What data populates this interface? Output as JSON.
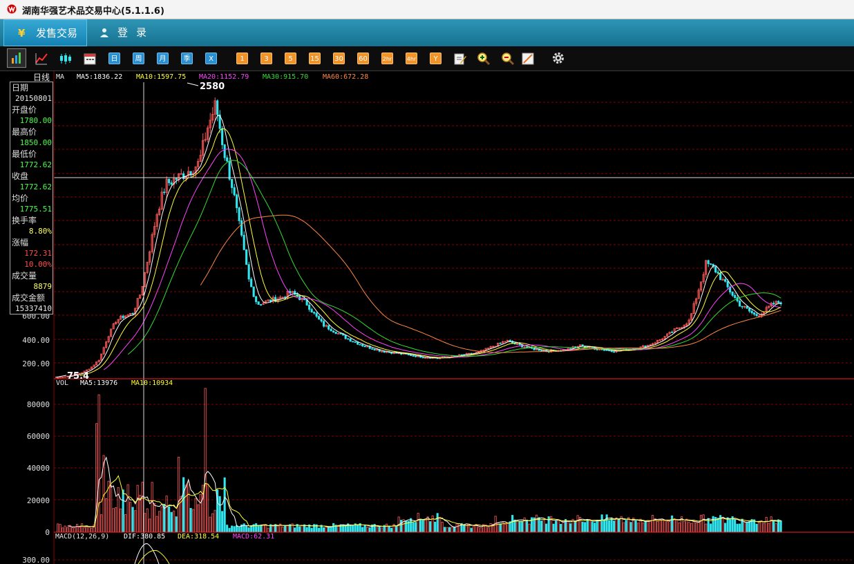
{
  "window": {
    "title": "湖南华强艺术品交易中心(5.1.1.6)"
  },
  "nav": {
    "tabs": [
      {
        "label": "发售交易",
        "icon": "yen-icon"
      },
      {
        "label": "登录",
        "icon": "user-icon"
      }
    ]
  },
  "toolbar": {
    "icon_buttons": [
      "bar-chart-icon",
      "line-chart-icon",
      "candlestick-icon",
      "calendar-icon"
    ],
    "period_buttons": [
      "日",
      "周",
      "月",
      "季",
      "X"
    ],
    "minute_buttons": [
      "1",
      "3",
      "5",
      "15",
      "30",
      "60",
      "2hr",
      "4hr",
      "Y"
    ],
    "tool_buttons": [
      "edit-icon",
      "zoom-in-icon",
      "zoom-out-icon",
      "draw-line-icon",
      "gear-icon"
    ]
  },
  "main_pane": {
    "period_label": "日线",
    "ma_label": "MA",
    "ma5": "MA5:1836.22",
    "ma10": "MA10:1597.75",
    "ma20": "MA20:1152.79",
    "ma30": "MA30:915.70",
    "ma60": "MA60:672.28",
    "y_ticks": [
      "600.00",
      "400.00",
      "200.00"
    ],
    "high_label": "2580",
    "low_label": "75.4"
  },
  "vol_pane": {
    "label": "VOL",
    "ma5": "MA5:13976",
    "ma10": "MA10:10934",
    "y_ticks": [
      "80000",
      "60000",
      "40000",
      "20000",
      "0"
    ]
  },
  "macd_pane": {
    "label": "MACD(12,26,9)",
    "dif": "DIF:380.85",
    "dea": "DEA:318.54",
    "macd": "MACD:62.31",
    "y_ticks": [
      "300.00"
    ]
  },
  "info": {
    "fields": [
      {
        "label": "日期",
        "value": "20150801",
        "color": "#e8e8e8"
      },
      {
        "label": "开盘价",
        "value": "1780.00",
        "color": "#4cff4c"
      },
      {
        "label": "最高价",
        "value": "1850.00",
        "color": "#4cff4c"
      },
      {
        "label": "最低价",
        "value": "1772.62",
        "color": "#4cff4c"
      },
      {
        "label": "收盘",
        "value": "1772.62",
        "color": "#4cff4c"
      },
      {
        "label": "均价",
        "value": "1775.51",
        "color": "#4cff4c"
      },
      {
        "label": "换手率",
        "value": "8.80%",
        "color": "#ffff66"
      },
      {
        "label": "涨幅",
        "value": "172.31",
        "value2": "10.00%",
        "color": "#ff5050"
      },
      {
        "label": "成交量",
        "value": "8879",
        "color": "#ffff66"
      },
      {
        "label": "成交金额",
        "value": "15337410",
        "color": "#e8e8e8"
      }
    ]
  },
  "colors": {
    "up": "#ff5a5a",
    "down": "#31e6ef",
    "grid": "#8b0000",
    "ma5": "#ffffff",
    "ma10": "#ffff33",
    "ma20": "#ff44ff",
    "ma30": "#33dd33",
    "ma60": "#ff8844"
  },
  "chart_data": {
    "type": "candlestick",
    "main": {
      "y_ticks": [
        200,
        400,
        600
      ],
      "close_series": [
        75,
        85,
        100,
        120,
        160,
        230,
        420,
        560,
        600,
        620,
        800,
        1150,
        1500,
        1720,
        1760,
        1800,
        1850,
        1900,
        2200,
        2400,
        2000,
        1700,
        1300,
        900,
        700,
        720,
        740,
        760,
        800,
        760,
        700,
        600,
        520,
        480,
        440,
        400,
        370,
        340,
        320,
        300,
        290,
        280,
        270,
        260,
        250,
        245,
        240,
        250,
        260,
        270,
        280,
        300,
        330,
        360,
        390,
        360,
        340,
        320,
        310,
        300,
        305,
        310,
        330,
        350,
        330,
        320,
        310,
        300,
        310,
        320,
        330,
        350,
        380,
        420,
        470,
        510,
        560,
        800,
        1050,
        1000,
        900,
        800,
        700,
        650,
        600,
        640,
        700,
        720
      ]
    },
    "volume": {
      "y_ticks": [
        0,
        20000,
        40000,
        60000,
        80000
      ]
    },
    "macd": {
      "dif": 380.85,
      "dea": 318.54,
      "macd": 62.31
    }
  }
}
